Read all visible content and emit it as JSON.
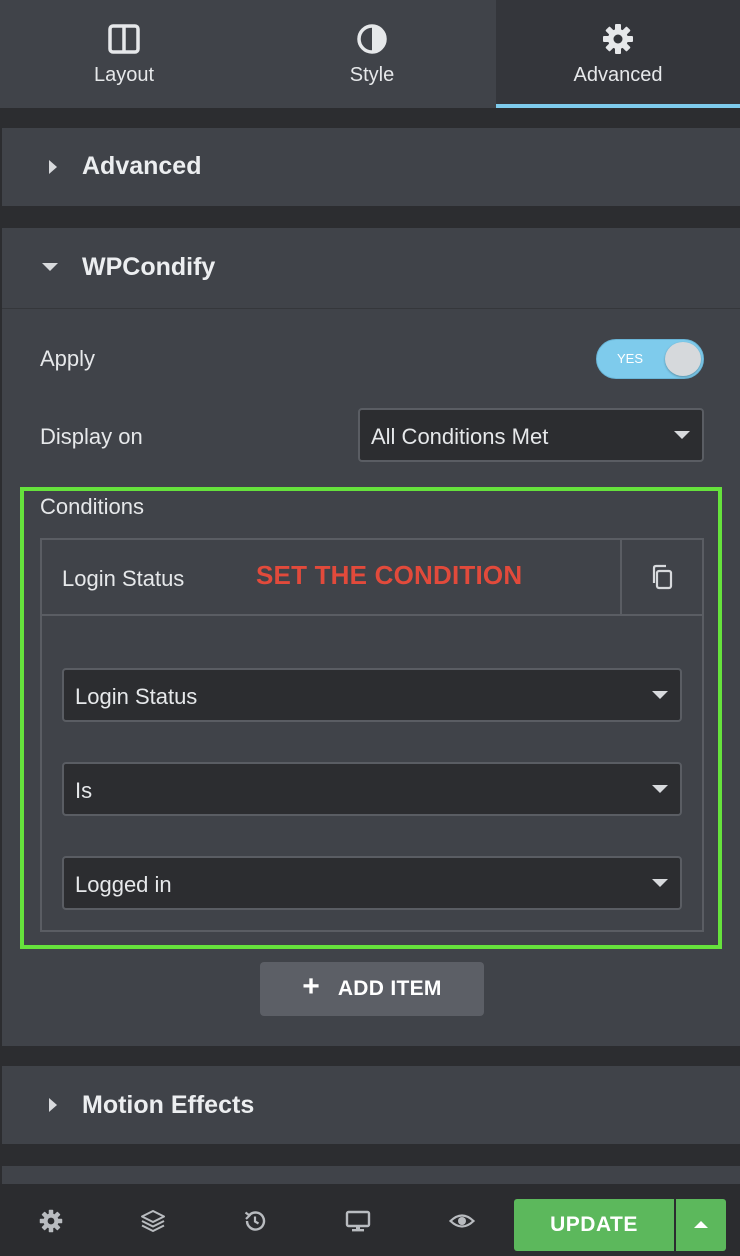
{
  "tabs": [
    {
      "label": "Layout",
      "icon": "layout-columns-icon"
    },
    {
      "label": "Style",
      "icon": "contrast-half-circle-icon"
    },
    {
      "label": "Advanced",
      "icon": "gear-icon",
      "active": true
    }
  ],
  "sections": {
    "advanced": {
      "title": "Advanced",
      "expanded": false
    },
    "wpcondify": {
      "title": "WPCondify",
      "expanded": true
    },
    "motion_effects": {
      "title": "Motion Effects",
      "expanded": false
    }
  },
  "wpcondify": {
    "apply_label": "Apply",
    "apply_toggle_text": "YES",
    "apply_enabled": true,
    "display_on_label": "Display on",
    "display_on_value": "All Conditions Met",
    "conditions_label": "Conditions",
    "condition_item_title": "Login Status",
    "annotation": "SET THE CONDITION",
    "condition_type": "Login Status",
    "operator": "Is",
    "value": "Logged in",
    "add_item_label": "ADD ITEM"
  },
  "footer": {
    "icons": [
      "gear-icon",
      "layers-icon",
      "history-icon",
      "desktop-icon",
      "eye-icon"
    ],
    "update_label": "UPDATE"
  },
  "colors": {
    "accent": "#7ecbec",
    "update_green": "#5cb85c",
    "highlight_green": "#66e23c",
    "annotation_red": "#e24a3b"
  }
}
